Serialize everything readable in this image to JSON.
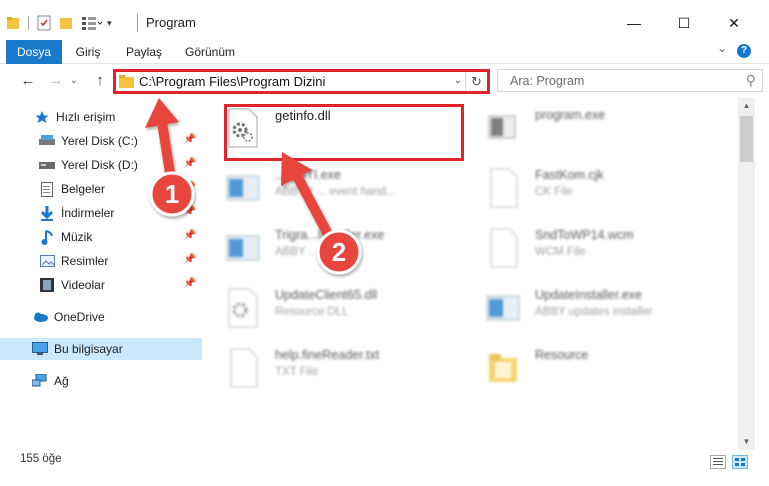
{
  "window": {
    "title": "Program",
    "minimize_glyph": "—",
    "maximize_glyph": "☐",
    "close_glyph": "✕"
  },
  "ribbon": {
    "tabs": [
      "Dosya",
      "Giriş",
      "Paylaş",
      "Görünüm"
    ],
    "expand_glyph": "⌄",
    "help_glyph": "?"
  },
  "address_bar": {
    "path": "C:\\Program Files\\Program Dizini",
    "dropdown_glyph": "⌄",
    "refresh_glyph": "↻"
  },
  "nav_buttons": {
    "back": "←",
    "forward": "→",
    "recent": "⌄",
    "up": "↑"
  },
  "search": {
    "placeholder": "Ara: Program",
    "icon_glyph": "⚲"
  },
  "nav_pane": {
    "items": [
      {
        "label": "Hızlı erişim",
        "icon": "star-icon",
        "pinned": false
      },
      {
        "label": "Yerel Disk (C:)",
        "icon": "drive-icon",
        "pinned": true
      },
      {
        "label": "Yerel Disk (D:)",
        "icon": "drive-icon",
        "pinned": true
      },
      {
        "label": "Belgeler",
        "icon": "documents-icon",
        "pinned": true
      },
      {
        "label": "İndirmeler",
        "icon": "download-icon",
        "pinned": true
      },
      {
        "label": "Müzik",
        "icon": "music-icon",
        "pinned": true
      },
      {
        "label": "Resimler",
        "icon": "pictures-icon",
        "pinned": true
      },
      {
        "label": "Videolar",
        "icon": "video-icon",
        "pinned": true
      },
      {
        "label": "OneDrive",
        "icon": "cloud-icon",
        "pinned": false
      },
      {
        "label": "Bu bilgisayar",
        "icon": "computer-icon",
        "pinned": false,
        "selected": true
      },
      {
        "label": "Ağ",
        "icon": "network-icon",
        "pinned": false
      }
    ],
    "pin_glyph": "📌"
  },
  "files": [
    {
      "name": "getinfo.dll",
      "type": "",
      "icon": "dll-gear-icon",
      "highlighted": true
    },
    {
      "name": "program.exe",
      "type": "",
      "icon": "exe-icon"
    },
    {
      "name": "...yySTI.exe",
      "type": "ABBYY ... event hand...",
      "icon": "window-exe-icon"
    },
    {
      "name": "FastKom.cjk",
      "type": "CK File",
      "icon": "blank-file-icon"
    },
    {
      "name": "Trigra...Installer.exe",
      "type": "ABBY ... der to...",
      "icon": "window-exe-icon"
    },
    {
      "name": "SndToWP14.wcm",
      "type": "WCM File",
      "icon": "blank-file-icon"
    },
    {
      "name": "UpdateClient65.dll",
      "type": "Resource DLL",
      "icon": "dll-gear-icon"
    },
    {
      "name": "UpdateInstaller.exe",
      "type": "ABBY updates installer",
      "icon": "window-exe-icon"
    },
    {
      "name": "help.fineReader.txt",
      "type": "TXT File",
      "icon": "blank-file-icon"
    },
    {
      "name": "Resource",
      "type": "",
      "icon": "folder-icon"
    }
  ],
  "status": {
    "item_count": "155 öğe"
  },
  "annotations": {
    "step1": "1",
    "step2": "2"
  },
  "colors": {
    "accent": "#1979ca",
    "highlight_red": "#e0242c",
    "selection": "#cce8ff"
  }
}
